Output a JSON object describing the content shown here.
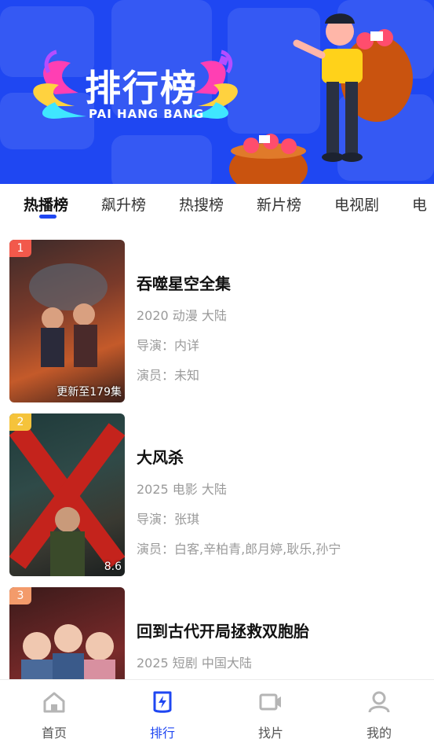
{
  "banner": {
    "title": "排行榜",
    "subtitle": "PAI HANG BANG"
  },
  "tabs": [
    {
      "label": "热播榜",
      "active": true
    },
    {
      "label": "飙升榜",
      "active": false
    },
    {
      "label": "热搜榜",
      "active": false
    },
    {
      "label": "新片榜",
      "active": false
    },
    {
      "label": "电视剧",
      "active": false
    },
    {
      "label": "电",
      "active": false
    }
  ],
  "list": [
    {
      "rank": "1",
      "rank_color": "#f2594b",
      "badge": "更新至179集",
      "title": "吞噬星空全集",
      "info": "2020 动漫 大陆",
      "director": "导演：内详",
      "actors": "演员：未知"
    },
    {
      "rank": "2",
      "rank_color": "#f5c33b",
      "badge": "8.6",
      "title": "大风杀",
      "info": "2025 电影 大陆",
      "director": "导演：张琪",
      "actors": "演员：白客,辛柏青,郎月婷,耿乐,孙宁"
    },
    {
      "rank": "3",
      "rank_color": "#f39b6b",
      "badge": "",
      "title": "回到古代开局拯救双胞胎",
      "info": "2025 短剧 中国大陆",
      "director": "",
      "actors": ""
    }
  ],
  "nav": [
    {
      "label": "首页",
      "icon": "home-icon",
      "active": false
    },
    {
      "label": "排行",
      "icon": "ranking-icon",
      "active": true
    },
    {
      "label": "找片",
      "icon": "video-camera-icon",
      "active": false
    },
    {
      "label": "我的",
      "icon": "user-icon",
      "active": false
    }
  ],
  "colors": {
    "accent": "#1f47f2",
    "title_text": "#111111",
    "meta_text": "#9a9a9a"
  }
}
